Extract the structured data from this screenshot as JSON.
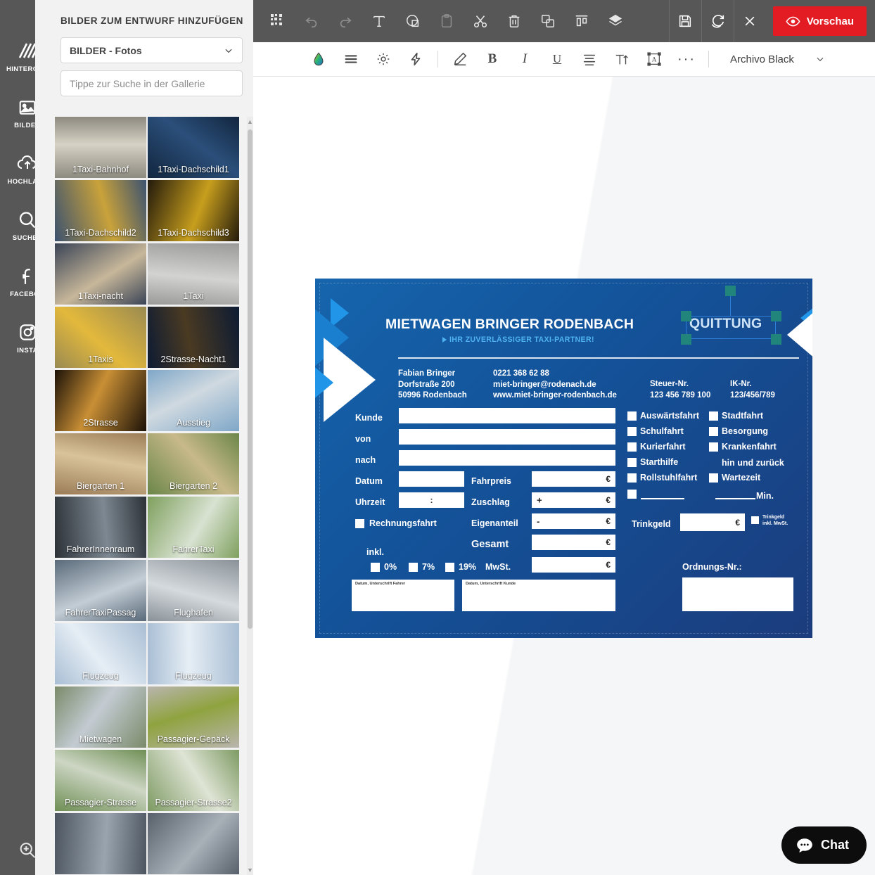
{
  "rail": {
    "items": [
      {
        "label": "HINTERGRU",
        "icon": "hatch-pattern-icon",
        "name": "hintergrund"
      },
      {
        "label": "BILDER",
        "icon": "image-icon",
        "name": "bilder",
        "active": true
      },
      {
        "label": "HOCHLADE",
        "icon": "cloud-upload-icon",
        "name": "hochladen"
      },
      {
        "label": "SUCHEN",
        "icon": "search-icon",
        "name": "suchen"
      },
      {
        "label": "FACEBOO",
        "icon": "facebook-icon",
        "name": "facebook"
      },
      {
        "label": "INSTA",
        "icon": "instagram-icon",
        "name": "instagram"
      }
    ],
    "zoom_icon": "zoom-in-icon"
  },
  "panel": {
    "title": "BILDER ZUM ENTWURF HINZUFÜGEN",
    "category_value": "BILDER - Fotos",
    "search_placeholder": "Tippe zur Suche in der Gallerie",
    "thumbnails": [
      {
        "caption": "1Taxi-Bahnhof",
        "c1": "#8d8a80",
        "c2": "#d6d2c4"
      },
      {
        "caption": "1Taxi-Dachschild1",
        "c1": "#12263f",
        "c2": "#2b4f7a"
      },
      {
        "caption": "1Taxi-Dachschild2",
        "c1": "#3c5270",
        "c2": "#c9a23a"
      },
      {
        "caption": "1Taxi-Dachschild3",
        "c1": "#231a0c",
        "c2": "#c79e1d"
      },
      {
        "caption": "1Taxi-nacht",
        "c1": "#3a4456",
        "c2": "#c7b79a"
      },
      {
        "caption": "1Taxi",
        "c1": "#9a9a98",
        "c2": "#d3d3d1"
      },
      {
        "caption": "1Taxis",
        "c1": "#9a8a52",
        "c2": "#e3b93c"
      },
      {
        "caption": "2Strasse-Nacht1",
        "c1": "#0d1b33",
        "c2": "#4a3a22"
      },
      {
        "caption": "2Strasse",
        "c1": "#1c1208",
        "c2": "#c98f35"
      },
      {
        "caption": "Ausstieg",
        "c1": "#7fa7c8",
        "c2": "#cfd9e0"
      },
      {
        "caption": "Biergarten 1",
        "c1": "#9b7d58",
        "c2": "#d9c39a"
      },
      {
        "caption": "Biergarten 2",
        "c1": "#6b8648",
        "c2": "#c8b98a"
      },
      {
        "caption": "FahrerInnenraum",
        "c1": "#2c3137",
        "c2": "#7d8892"
      },
      {
        "caption": "FahrerTaxi",
        "c1": "#7fa05e",
        "c2": "#d8e2d1"
      },
      {
        "caption": "FahrerTaxiPassag",
        "c1": "#5a6a7a",
        "c2": "#c3cdd5"
      },
      {
        "caption": "Flughafen",
        "c1": "#8a9299",
        "c2": "#d5dadd"
      },
      {
        "caption": "Flugzeug",
        "c1": "#a9bed4",
        "c2": "#e6eef5"
      },
      {
        "caption": "Flugzeug",
        "c1": "#a9bed4",
        "c2": "#e6eef5"
      },
      {
        "caption": "Mietwagen",
        "c1": "#7b8a6a",
        "c2": "#c3cbd2"
      },
      {
        "caption": "Passagier-Gepäck",
        "c1": "#b9b5ae",
        "c2": "#8fa33f"
      },
      {
        "caption": "Passagier-Strasse",
        "c1": "#6f8f55",
        "c2": "#cdd6c4"
      },
      {
        "caption": "Passagier-Strasse2",
        "c1": "#7d9a63",
        "c2": "#dfe4d5"
      },
      {
        "caption": "",
        "c1": "#4c5560",
        "c2": "#9aa4ae"
      },
      {
        "caption": "",
        "c1": "#58616b",
        "c2": "#a8b0b8"
      }
    ]
  },
  "toolbar": {
    "left_icons": [
      {
        "name": "qr-code-icon",
        "dim": false
      },
      {
        "name": "undo-icon",
        "dim": true
      },
      {
        "name": "redo-icon",
        "dim": true
      },
      {
        "name": "text-icon",
        "dim": false
      },
      {
        "name": "shape-icon",
        "dim": false
      },
      {
        "name": "clipboard-paste-icon",
        "dim": true
      },
      {
        "name": "scissors-cut-icon",
        "dim": false
      },
      {
        "name": "trash-delete-icon",
        "dim": false
      },
      {
        "name": "duplicate-copy-icon",
        "dim": false
      },
      {
        "name": "align-distribute-icon",
        "dim": false
      },
      {
        "name": "layers-icon",
        "dim": false
      }
    ],
    "right_boxes": [
      {
        "name": "save-icon"
      },
      {
        "name": "refresh-reset-icon"
      },
      {
        "name": "close-icon"
      }
    ],
    "preview_label": "Vorschau",
    "preview_icon": "eye-icon",
    "preview_color": "#e31b23"
  },
  "subtoolbar": {
    "icons": [
      {
        "name": "color-drop-icon"
      },
      {
        "name": "line-spacing-icon"
      },
      {
        "name": "brightness-icon"
      },
      {
        "name": "effects-bolt-icon"
      },
      {
        "name": "pen-edit-icon"
      },
      {
        "name": "bold-icon"
      },
      {
        "name": "italic-icon"
      },
      {
        "name": "underline-icon"
      },
      {
        "name": "text-align-icon"
      },
      {
        "name": "font-size-icon"
      },
      {
        "name": "text-box-icon"
      },
      {
        "name": "more-options-icon"
      }
    ],
    "font_name": "Archivo Black",
    "font_chevron": "chevron-down-icon"
  },
  "receipt": {
    "title": "MIETWAGEN BRINGER RODENBACH",
    "selected_text": "QUITTUNG",
    "subtitle": "IHR ZUVERLÄSSIGER TAXI-PARTNER!",
    "address_block1": [
      "Fabian Bringer",
      "Dorfstraße 200",
      "50996 Rodenbach"
    ],
    "address_block2": [
      "0221 368 62 88",
      "miet-bringer@rodenach.de",
      "www.miet-bringer-rodenbach.de"
    ],
    "steuer_label": "Steuer-Nr.",
    "steuer_value": "123 456 789 100",
    "ik_label": "IK-Nr.",
    "ik_value": "123/456/789",
    "labels": {
      "kunde": "Kunde",
      "von": "von",
      "nach": "nach",
      "datum": "Datum",
      "uhrzeit": "Uhrzeit",
      "rechnungsfahrt": "Rechnungsfahrt",
      "fahrpreis": "Fahrpreis",
      "zuschlag": "Zuschlag",
      "eigenanteil": "Eigenanteil",
      "gesamt": "Gesamt",
      "inkl": "inkl.",
      "mwst": "MwSt.",
      "mwst0": "0%",
      "mwst7": "7%",
      "mwst19": "19%",
      "trinkgeld": "Trinkgeld",
      "trinkgeld_inkl_1": "Trinkgeld",
      "trinkgeld_inkl_2": "inkl. MwSt.",
      "ordnungs": "Ordnungs-Nr.:",
      "hin_und_zurueck": "hin und zurück",
      "min": "Min.",
      "plus": "+",
      "minus": "-",
      "colon": ":",
      "euro": "€"
    },
    "checkboxes_col1": [
      "Auswärtsfahrt",
      "Schulfahrt",
      "Kurierfahrt",
      "Starthilfe",
      "Rollstuhlfahrt"
    ],
    "checkboxes_col2": [
      "Stadtfahrt",
      "Besorgung",
      "Krankenfahrt",
      "Wartezeit"
    ],
    "signature_left": "Datum, Unterschrift Fahrer",
    "signature_right": "Datum, Unterschrift Kunde",
    "colors": {
      "bg_dark": "#1b3c7d",
      "bg_light": "#1665ad",
      "accent": "#2196e8",
      "handle": "#21857b"
    }
  },
  "chat": {
    "label": "Chat",
    "icon": "chat-bubble-icon"
  }
}
